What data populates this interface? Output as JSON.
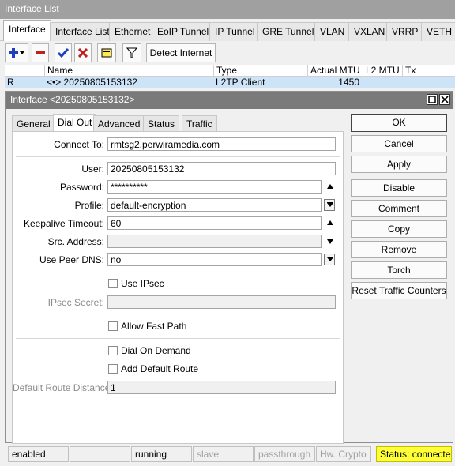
{
  "window": {
    "title": "Interface List"
  },
  "tabs": [
    "Interface",
    "Interface List",
    "Ethernet",
    "EoIP Tunnel",
    "IP Tunnel",
    "GRE Tunnel",
    "VLAN",
    "VXLAN",
    "VRRP",
    "VETH"
  ],
  "toolbar": {
    "icons": [
      "add-icon",
      "remove-icon",
      "enable-icon",
      "disable-icon",
      "comment-icon",
      "filter-icon"
    ],
    "detect_label": "Detect Internet"
  },
  "list": {
    "headers": [
      "Name",
      "Type",
      "Actual MTU",
      "L2 MTU",
      "Tx"
    ],
    "row": {
      "flag": "R",
      "name": "<•> 20250805153132",
      "type": "L2TP Client",
      "actual_mtu": "1450"
    }
  },
  "dialog": {
    "title": "Interface <20250805153132>",
    "tabs": [
      "General",
      "Dial Out",
      "Advanced",
      "Status",
      "Traffic"
    ],
    "fields": {
      "connect_to": {
        "label": "Connect To:",
        "value": "rmtsg2.perwiramedia.com"
      },
      "user": {
        "label": "User:",
        "value": "20250805153132"
      },
      "password": {
        "label": "Password:",
        "value": "**********"
      },
      "profile": {
        "label": "Profile:",
        "value": "default-encryption"
      },
      "keepalive": {
        "label": "Keepalive Timeout:",
        "value": "60"
      },
      "src_address": {
        "label": "Src. Address:",
        "value": ""
      },
      "use_peer_dns": {
        "label": "Use Peer DNS:",
        "value": "no"
      },
      "use_ipsec": {
        "label": "Use IPsec",
        "checked": false
      },
      "ipsec_secret": {
        "label": "IPsec Secret:",
        "value": ""
      },
      "allow_fast_path": {
        "label": "Allow Fast Path",
        "checked": false
      },
      "dial_on_demand": {
        "label": "Dial On Demand",
        "checked": false
      },
      "add_default_route": {
        "label": "Add Default Route",
        "checked": false
      },
      "default_route_distance": {
        "label": "Default Route Distance:",
        "value": "1"
      }
    },
    "buttons": [
      "OK",
      "Cancel",
      "Apply",
      "Disable",
      "Comment",
      "Copy",
      "Remove",
      "Torch",
      "Reset Traffic Counters"
    ]
  },
  "statusbar": {
    "cells": [
      "enabled",
      "",
      "running",
      "slave",
      "passthrough",
      "Hw. Crypto",
      "Status: connected"
    ],
    "highlight_color": "#ffff3a"
  }
}
